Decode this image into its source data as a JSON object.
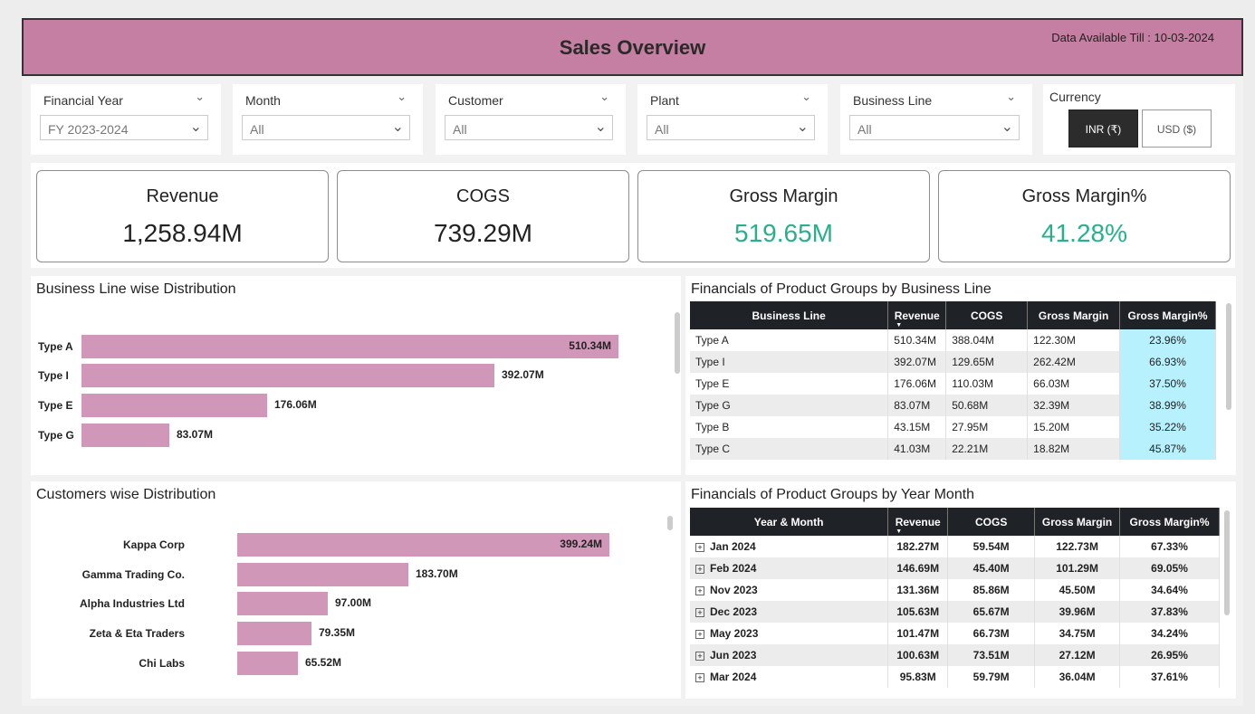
{
  "header": {
    "title": "Sales Overview",
    "data_available": "Data Available Till : 10-03-2024"
  },
  "filters": [
    {
      "label": "Financial Year",
      "value": "FY 2023-2024"
    },
    {
      "label": "Month",
      "value": "All"
    },
    {
      "label": "Customer",
      "value": "All"
    },
    {
      "label": "Plant",
      "value": "All"
    },
    {
      "label": "Business Line",
      "value": "All"
    }
  ],
  "currency": {
    "label": "Currency",
    "options": [
      "INR (₹)",
      "USD ($)"
    ],
    "selected": "INR (₹)"
  },
  "kpis": [
    {
      "label": "Revenue",
      "value": "1,258.94M",
      "color": "#222222"
    },
    {
      "label": "COGS",
      "value": "739.29M",
      "color": "#222222"
    },
    {
      "label": "Gross Margin",
      "value": "519.65M",
      "color": "#27b08c"
    },
    {
      "label": "Gross Margin%",
      "value": "41.28%",
      "color": "#27b08c"
    }
  ],
  "business_line_chart": {
    "title": "Business Line wise Distribution",
    "bar_color": "#d197b9",
    "chart_data": {
      "type": "bar",
      "orientation": "horizontal",
      "categories": [
        "Type A",
        "Type I",
        "Type E",
        "Type G"
      ],
      "values": [
        510.34,
        392.07,
        176.06,
        83.07
      ],
      "value_labels": [
        "510.34M",
        "392.07M",
        "176.06M",
        "83.07M"
      ]
    }
  },
  "customers_chart": {
    "title": "Customers wise Distribution",
    "bar_color": "#d197b9",
    "chart_data": {
      "type": "bar",
      "orientation": "horizontal",
      "categories": [
        "Kappa Corp",
        "Gamma Trading Co.",
        "Alpha Industries Ltd",
        "Zeta & Eta Traders",
        "Chi Labs"
      ],
      "values": [
        399.24,
        183.7,
        97.0,
        79.35,
        65.52
      ],
      "value_labels": [
        "399.24M",
        "183.70M",
        "97.00M",
        "79.35M",
        "65.52M"
      ]
    }
  },
  "bl_table": {
    "title": "Financials of Product Groups by Business Line",
    "columns": [
      "Business Line",
      "Revenue",
      "COGS",
      "Gross Margin",
      "Gross Margin%"
    ],
    "rows": [
      [
        "Type A",
        "510.34M",
        "388.04M",
        "122.30M",
        "23.96%"
      ],
      [
        "Type I",
        "392.07M",
        "129.65M",
        "262.42M",
        "66.93%"
      ],
      [
        "Type E",
        "176.06M",
        "110.03M",
        "66.03M",
        "37.50%"
      ],
      [
        "Type G",
        "83.07M",
        "50.68M",
        "32.39M",
        "38.99%"
      ],
      [
        "Type B",
        "43.15M",
        "27.95M",
        "15.20M",
        "35.22%"
      ],
      [
        "Type C",
        "41.03M",
        "22.21M",
        "18.82M",
        "45.87%"
      ]
    ],
    "highlight_color": "#b6f1fd"
  },
  "ym_table": {
    "title": "Financials of Product Groups by Year Month",
    "columns": [
      "Year & Month",
      "Revenue",
      "COGS",
      "Gross Margin",
      "Gross Margin%"
    ],
    "rows": [
      [
        "Jan 2024",
        "182.27M",
        "59.54M",
        "122.73M",
        "67.33%"
      ],
      [
        "Feb 2024",
        "146.69M",
        "45.40M",
        "101.29M",
        "69.05%"
      ],
      [
        "Nov 2023",
        "131.36M",
        "85.86M",
        "45.50M",
        "34.64%"
      ],
      [
        "Dec 2023",
        "105.63M",
        "65.67M",
        "39.96M",
        "37.83%"
      ],
      [
        "May 2023",
        "101.47M",
        "66.73M",
        "34.75M",
        "34.24%"
      ],
      [
        "Jun 2023",
        "100.63M",
        "73.51M",
        "27.12M",
        "26.95%"
      ],
      [
        "Mar 2024",
        "95.83M",
        "59.79M",
        "36.04M",
        "37.61%"
      ]
    ]
  }
}
